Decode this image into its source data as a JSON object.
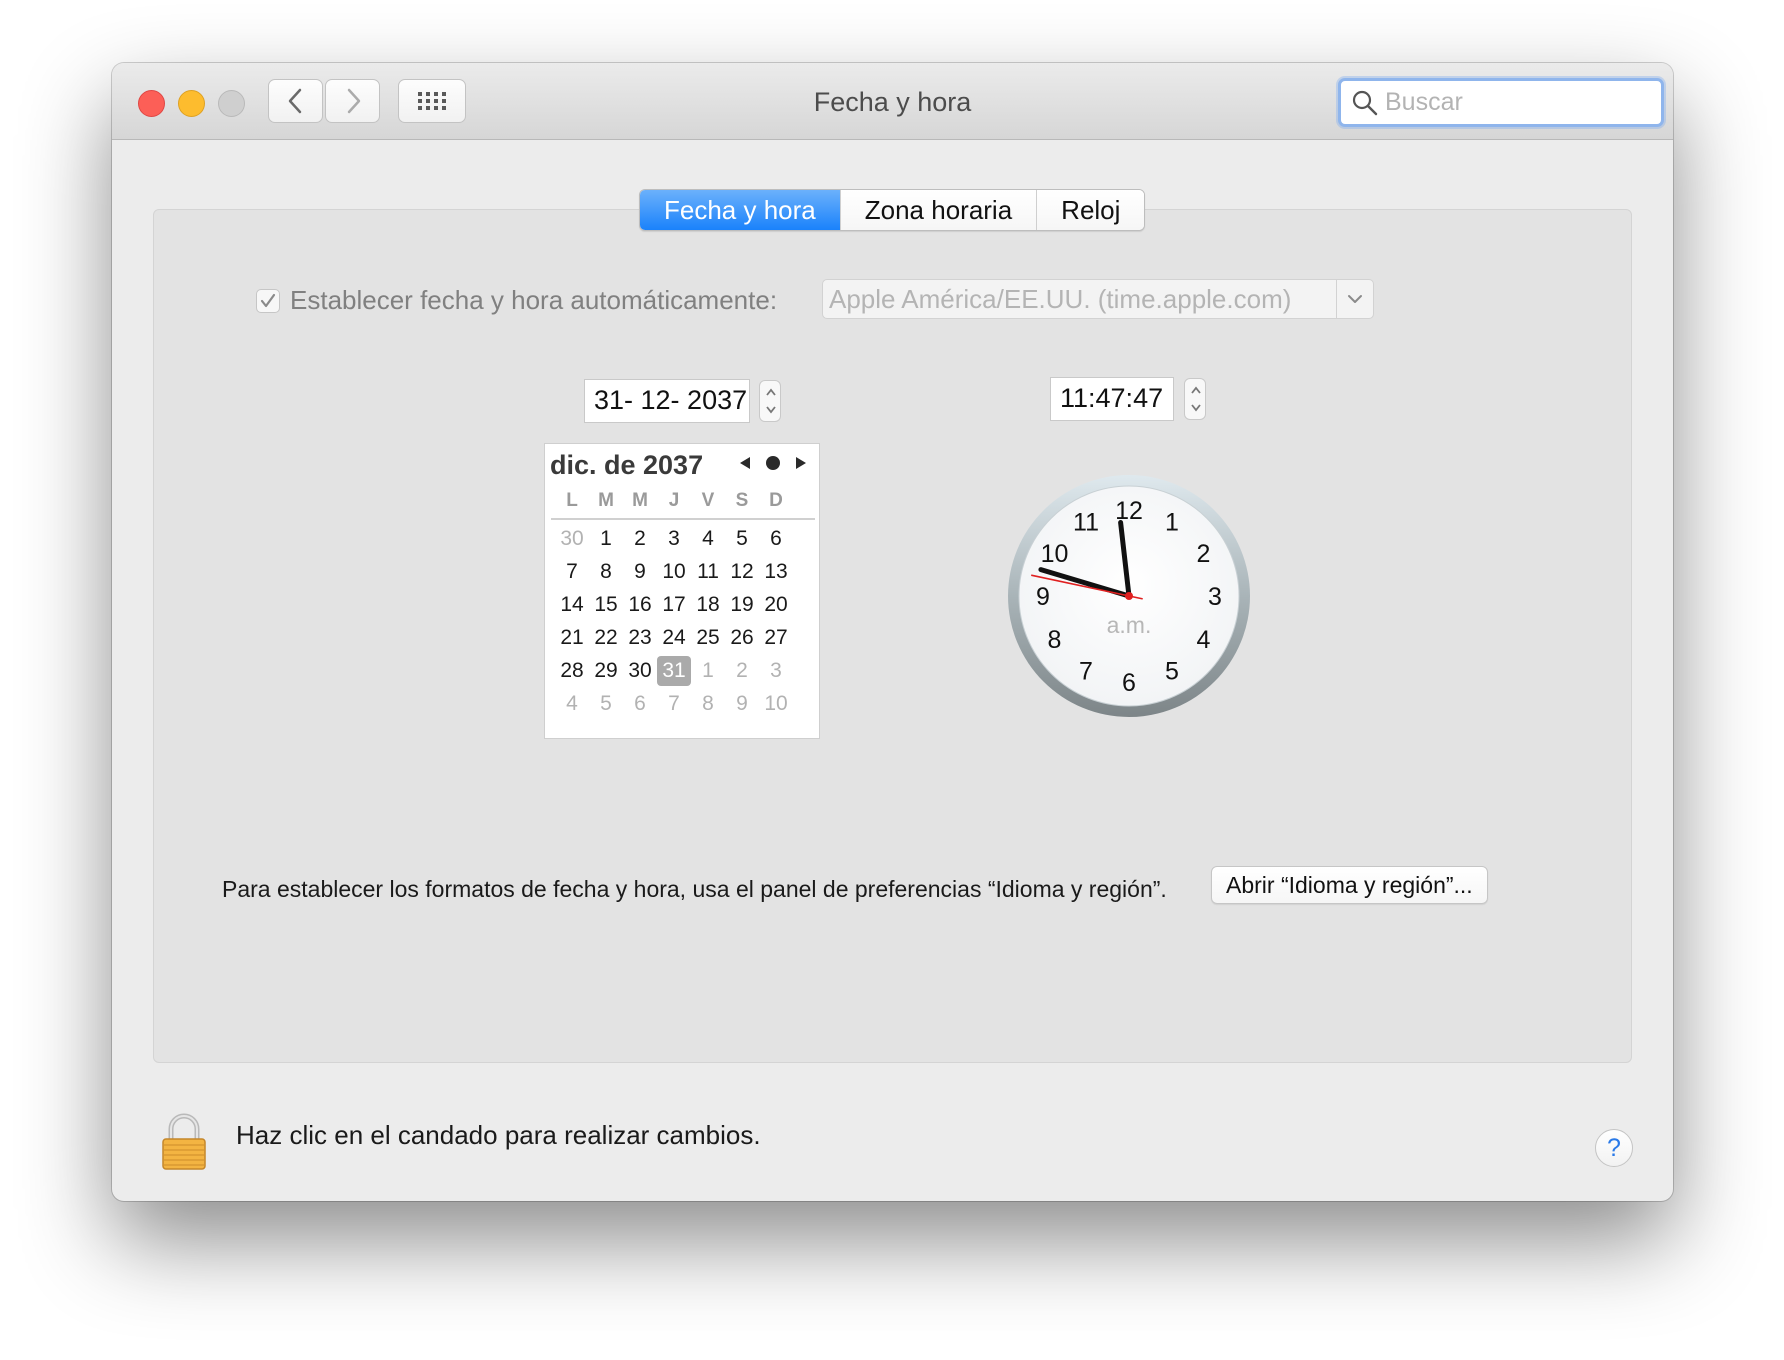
{
  "window": {
    "title": "Fecha y hora",
    "search_placeholder": "Buscar"
  },
  "tabs": [
    {
      "label": "Fecha y hora",
      "active": true
    },
    {
      "label": "Zona horaria",
      "active": false
    },
    {
      "label": "Reloj",
      "active": false
    }
  ],
  "auto": {
    "label": "Establecer fecha y hora automáticamente:",
    "checked": true,
    "server": "Apple América/EE.UU. (time.apple.com)"
  },
  "date_field": "31- 12- 2037",
  "time_field": "11:47:47",
  "calendar": {
    "title": "dic. de 2037",
    "weekdays": [
      "L",
      "M",
      "M",
      "J",
      "V",
      "S",
      "D"
    ],
    "selected_day": "31",
    "weeks": [
      [
        [
          "30",
          true
        ],
        [
          "1",
          false
        ],
        [
          "2",
          false
        ],
        [
          "3",
          false
        ],
        [
          "4",
          false
        ],
        [
          "5",
          false
        ],
        [
          "6",
          false
        ]
      ],
      [
        [
          "7",
          false
        ],
        [
          "8",
          false
        ],
        [
          "9",
          false
        ],
        [
          "10",
          false
        ],
        [
          "11",
          false
        ],
        [
          "12",
          false
        ],
        [
          "13",
          false
        ]
      ],
      [
        [
          "14",
          false
        ],
        [
          "15",
          false
        ],
        [
          "16",
          false
        ],
        [
          "17",
          false
        ],
        [
          "18",
          false
        ],
        [
          "19",
          false
        ],
        [
          "20",
          false
        ]
      ],
      [
        [
          "21",
          false
        ],
        [
          "22",
          false
        ],
        [
          "23",
          false
        ],
        [
          "24",
          false
        ],
        [
          "25",
          false
        ],
        [
          "26",
          false
        ],
        [
          "27",
          false
        ]
      ],
      [
        [
          "28",
          false
        ],
        [
          "29",
          false
        ],
        [
          "30",
          false
        ],
        [
          "31",
          false
        ],
        [
          "1",
          true
        ],
        [
          "2",
          true
        ],
        [
          "3",
          true
        ]
      ],
      [
        [
          "4",
          true
        ],
        [
          "5",
          true
        ],
        [
          "6",
          true
        ],
        [
          "7",
          true
        ],
        [
          "8",
          true
        ],
        [
          "9",
          true
        ],
        [
          "10",
          true
        ]
      ]
    ]
  },
  "clock": {
    "hour": 11,
    "minute": 47,
    "second": 47,
    "period_label": "a.m.",
    "numbers": [
      "12",
      "1",
      "2",
      "3",
      "4",
      "5",
      "6",
      "7",
      "8",
      "9",
      "10",
      "11"
    ]
  },
  "formats": {
    "text": "Para establecer los formatos de fecha y hora, usa el panel de preferencias “Idioma y región”.",
    "button": "Abrir “Idioma y región”..."
  },
  "footer": {
    "lock_text": "Haz clic en el candado para realizar cambios.",
    "help": "?"
  },
  "colors": {
    "accent": "#1a82fb",
    "close": "#fc5f57",
    "minimize": "#fdbc2e",
    "second_hand": "#e02020"
  }
}
